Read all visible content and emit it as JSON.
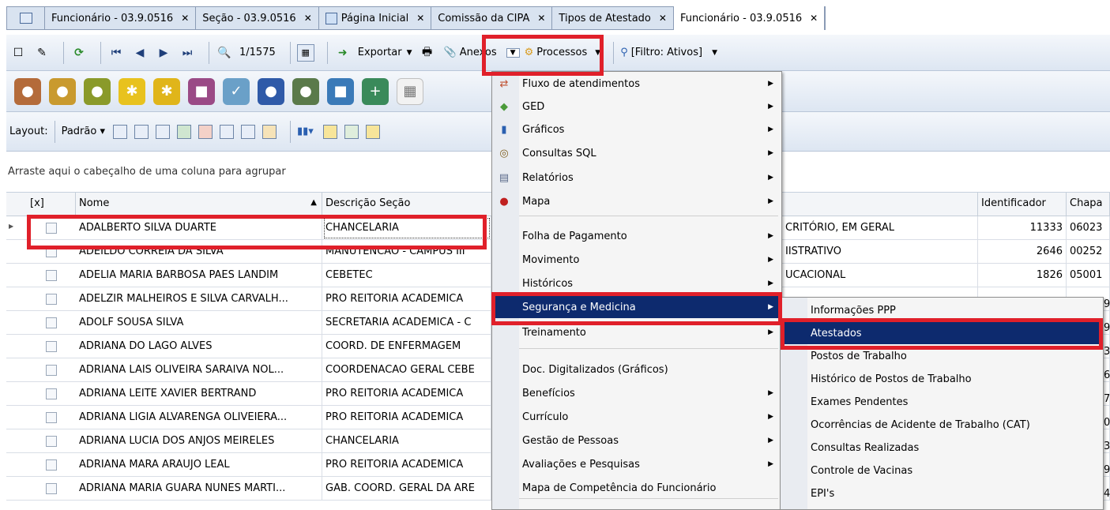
{
  "tabs": [
    {
      "label": "Funcionário - 03.9.0516"
    },
    {
      "label": "Seção - 03.9.0516"
    },
    {
      "label": "Página Inicial"
    },
    {
      "label": "Comissão da CIPA"
    },
    {
      "label": "Tipos de Atestado"
    },
    {
      "label": "Funcionário - 03.9.0516",
      "active": true
    }
  ],
  "toolbar": {
    "record_counter": "1/1575",
    "export_label": "Exportar",
    "anexos_label": "Anexos",
    "processos_label": "Processos",
    "filter_label": "[Filtro: Ativos]"
  },
  "layout_bar": {
    "layout_label": "Layout:",
    "padrao_label": "Padrão"
  },
  "group_area_text": "Arraste aqui o cabeçalho de uma coluna para agrupar",
  "grid": {
    "columns": [
      "[x]",
      "Nome",
      "Descrição Seção",
      "Identificador",
      "Chapa"
    ],
    "rows": [
      {
        "nome": "ADALBERTO SILVA DUARTE",
        "secao": "CHANCELARIA",
        "func": "CRITÓRIO, EM GERAL",
        "id": "11333",
        "chapa": "06023"
      },
      {
        "nome": "ADEILDO CORREIA DA SILVA",
        "secao": "MANUTENCAO - CAMPUS III",
        "func": "IISTRATIVO",
        "id": "2646",
        "chapa": "00252"
      },
      {
        "nome": "ADELIA MARIA BARBOSA PAES LANDIM",
        "secao": "CEBETEC",
        "func": "UCACIONAL",
        "id": "1826",
        "chapa": "05001"
      },
      {
        "nome": "ADELZIR MALHEIROS E SILVA CARVALH...",
        "secao": "PRO REITORIA ACADEMICA",
        "func": "",
        "id": "",
        "chapa": ""
      },
      {
        "nome": "ADOLF SOUSA SILVA",
        "secao": "SECRETARIA ACADEMICA - C",
        "func": "",
        "id": "",
        "chapa": ""
      },
      {
        "nome": "ADRIANA DO LAGO ALVES",
        "secao": "COORD. DE ENFERMAGEM",
        "func": "",
        "id": "",
        "chapa": ""
      },
      {
        "nome": "ADRIANA LAIS OLIVEIRA SARAIVA NOL...",
        "secao": "COORDENACAO GERAL CEBE",
        "func": "",
        "id": "",
        "chapa": ""
      },
      {
        "nome": "ADRIANA LEITE XAVIER BERTRAND",
        "secao": "PRO REITORIA ACADEMICA",
        "func": "",
        "id": "",
        "chapa": ""
      },
      {
        "nome": "ADRIANA LIGIA ALVARENGA OLIVEIERA...",
        "secao": "PRO REITORIA ACADEMICA",
        "func": "",
        "id": "",
        "chapa": ""
      },
      {
        "nome": "ADRIANA LUCIA DOS ANJOS MEIRELES",
        "secao": "CHANCELARIA",
        "func": "",
        "id": "",
        "chapa": ""
      },
      {
        "nome": "ADRIANA MARA ARAUJO LEAL",
        "secao": "PRO REITORIA ACADEMICA",
        "func": "",
        "id": "",
        "chapa": ""
      },
      {
        "nome": "ADRIANA MARIA GUARA NUNES MARTI...",
        "secao": "GAB. COORD. GERAL DA ARE",
        "func": "",
        "id": "",
        "chapa": ""
      }
    ]
  },
  "anexos_menu": [
    {
      "label": "Fluxo de atendimentos",
      "submenu": true
    },
    {
      "label": "GED",
      "submenu": true
    },
    {
      "label": "Gráficos",
      "submenu": true
    },
    {
      "label": "Consultas SQL",
      "submenu": true
    },
    {
      "label": "Relatórios",
      "submenu": true
    },
    {
      "label": "Mapa",
      "submenu": true
    },
    {
      "label": "Folha de Pagamento",
      "submenu": true
    },
    {
      "label": "Movimento",
      "submenu": true
    },
    {
      "label": "Históricos",
      "submenu": true
    },
    {
      "label": "Segurança e Medicina",
      "submenu": true
    },
    {
      "label": "Treinamento",
      "submenu": true
    },
    {
      "label": "Doc. Digitalizados (Gráficos)",
      "submenu": false
    },
    {
      "label": "Benefícios",
      "submenu": true
    },
    {
      "label": "Currículo",
      "submenu": true
    },
    {
      "label": "Gestão de Pessoas",
      "submenu": true
    },
    {
      "label": "Avaliações e Pesquisas",
      "submenu": true
    },
    {
      "label": "Mapa de Competência do Funcionário",
      "submenu": false
    }
  ],
  "seguranca_submenu": [
    {
      "label": "Informações PPP"
    },
    {
      "label": "Atestados"
    },
    {
      "label": "Postos de Trabalho"
    },
    {
      "label": "Histórico de Postos de Trabalho"
    },
    {
      "label": "Exames Pendentes"
    },
    {
      "label": "Ocorrências de Acidente de Trabalho (CAT)"
    },
    {
      "label": "Consultas Realizadas"
    },
    {
      "label": "Controle de Vacinas"
    },
    {
      "label": "EPI's"
    }
  ],
  "right_edge_digits": [
    "9",
    "9",
    "3",
    "6",
    "7",
    "0",
    "3",
    "9",
    "4"
  ],
  "colors": {
    "highlight": "#0d2a6e",
    "annotation": "#e0202a"
  }
}
